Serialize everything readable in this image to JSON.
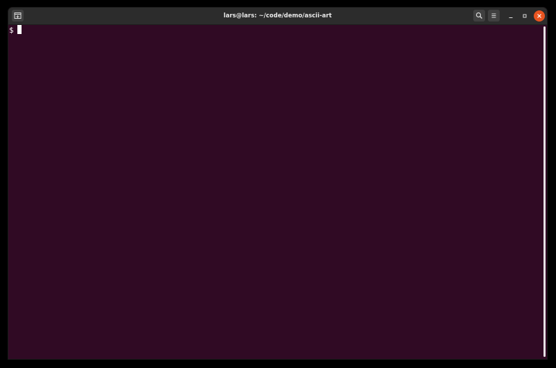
{
  "window": {
    "title": "lars@lars: ~/code/demo/ascii-art"
  },
  "titlebar": {
    "buttons": [
      {
        "name": "new-tab",
        "icon": "new-tab-icon"
      },
      {
        "name": "search",
        "icon": "search-icon"
      },
      {
        "name": "menu",
        "icon": "hamburger-menu-icon"
      },
      {
        "name": "minimize",
        "icon": "minimize-icon"
      },
      {
        "name": "maximize",
        "icon": "maximize-icon"
      },
      {
        "name": "close",
        "icon": "close-icon"
      }
    ]
  },
  "terminal": {
    "prompt": "$",
    "input": ""
  },
  "colors": {
    "terminal_bg": "#300a24",
    "titlebar_bg": "#2c2c2c",
    "close_button": "#e95420",
    "text": "#ffffff"
  }
}
